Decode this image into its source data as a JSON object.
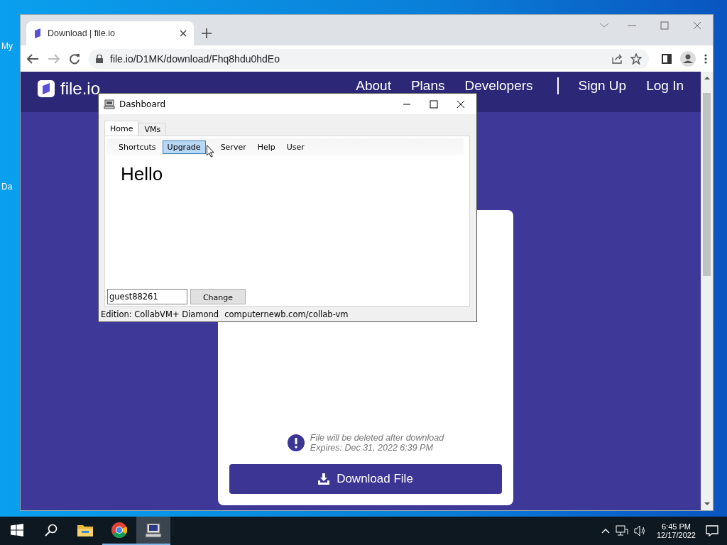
{
  "desktop": {
    "icon_labels": [
      "My",
      "Da"
    ]
  },
  "browser": {
    "tabs": [
      {
        "title": "Download | file.io",
        "selected": true
      }
    ],
    "address": "file.io/D1MK/download/Fhq8hdu0hdEo"
  },
  "site": {
    "logo": "file.io",
    "nav": [
      {
        "label": "About"
      },
      {
        "label": "Plans"
      },
      {
        "label": "Developers"
      },
      {
        "label": "Sign Up"
      },
      {
        "label": "Log In"
      }
    ],
    "notice": [
      "File will be deleted after download",
      "Expires: Dec 31, 2022 6:39 PM"
    ],
    "download_button": "Download File"
  },
  "dashboard": {
    "title": "Dashboard",
    "tabs": [
      {
        "label": "Home",
        "selected": true
      },
      {
        "label": "VMs",
        "selected": false
      }
    ],
    "menu": [
      {
        "label": "Shortcuts",
        "selected": false
      },
      {
        "label": "Upgrade",
        "selected": true
      },
      {
        "label": "Server",
        "selected": false
      },
      {
        "label": "Help",
        "selected": false
      },
      {
        "label": "User",
        "selected": false
      }
    ],
    "greeting": "Hello",
    "username": "guest88261",
    "change_button": "Change",
    "status": [
      "Edition: CollabVM+ Diamond",
      "computernewb.com/collab-vm"
    ]
  },
  "taskbar": {
    "apps": [
      {
        "kind": "explorer",
        "running": false,
        "selected": false
      },
      {
        "kind": "chrome",
        "running": true,
        "selected": false
      },
      {
        "kind": "dashboard",
        "running": true,
        "selected": true
      }
    ],
    "time": "6:45 PM",
    "date": "12/17/2022"
  }
}
